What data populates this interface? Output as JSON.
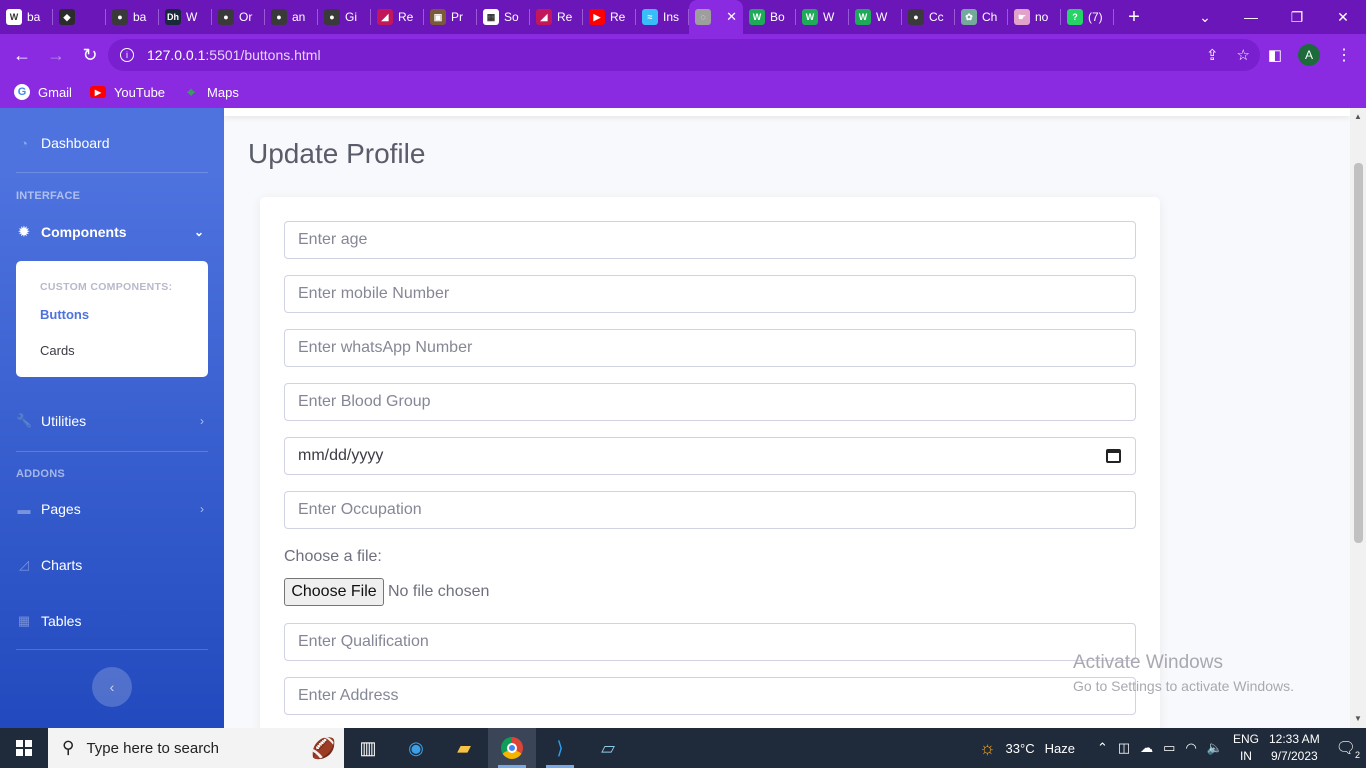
{
  "browser": {
    "tabs": [
      {
        "label": "ba",
        "icon": "w-icon",
        "color": "#ffffff",
        "text": "W"
      },
      {
        "label": "",
        "icon": "diamond-icon",
        "color": "#2c2c2c",
        "text": "◆"
      },
      {
        "label": "ba",
        "icon": "github-icon",
        "color": "#3a3a3a",
        "text": "●"
      },
      {
        "label": "W",
        "icon": "dh-icon",
        "color": "#1b2a3a",
        "text": "Dh"
      },
      {
        "label": "Or",
        "icon": "github-icon",
        "color": "#3a3a3a",
        "text": "●"
      },
      {
        "label": "an",
        "icon": "github-icon",
        "color": "#3a3a3a",
        "text": "●"
      },
      {
        "label": "Gi",
        "icon": "github-icon",
        "color": "#3a3a3a",
        "text": "●"
      },
      {
        "label": "Re",
        "icon": "redux-icon",
        "color": "#c2185b",
        "text": "◢"
      },
      {
        "label": "Pr",
        "icon": "photo-icon",
        "color": "#7a5a3a",
        "text": "▣"
      },
      {
        "label": "So",
        "icon": "square-icon",
        "color": "#ffffff",
        "text": "▦"
      },
      {
        "label": "Re",
        "icon": "redux-icon",
        "color": "#c2185b",
        "text": "◢"
      },
      {
        "label": "Re",
        "icon": "youtube-icon",
        "color": "#ff0000",
        "text": "▶"
      },
      {
        "label": "Ins",
        "icon": "tailwind-icon",
        "color": "#38bdf8",
        "text": "≈"
      },
      {
        "label": "",
        "icon": "globe-icon",
        "color": "#9e9e9e",
        "text": "◌",
        "active": true
      },
      {
        "label": "Bo",
        "icon": "w-green-icon",
        "color": "#1faa59",
        "text": "W"
      },
      {
        "label": "W",
        "icon": "w-green-icon",
        "color": "#1faa59",
        "text": "W"
      },
      {
        "label": "W",
        "icon": "w-green-icon",
        "color": "#1faa59",
        "text": "W"
      },
      {
        "label": "Cc",
        "icon": "github-icon",
        "color": "#3a3a3a",
        "text": "●"
      },
      {
        "label": "Ch",
        "icon": "chatgpt-icon",
        "color": "#74aa9c",
        "text": "✿"
      },
      {
        "label": "no",
        "icon": "hand-icon",
        "color": "#e1a3c9",
        "text": "☛"
      },
      {
        "label": "(7)",
        "icon": "whatsapp-icon",
        "color": "#25d366",
        "text": "?"
      }
    ],
    "address_host": "127.0.0.1",
    "address_path": ":5501/buttons.html",
    "avatar_letter": "A",
    "bookmarks": [
      {
        "label": "Gmail",
        "icon": "google-icon"
      },
      {
        "label": "YouTube",
        "icon": "youtube-icon"
      },
      {
        "label": "Maps",
        "icon": "maps-icon"
      }
    ]
  },
  "sidebar": {
    "dashboard": "Dashboard",
    "heading_interface": "INTERFACE",
    "components": "Components",
    "collapse_header": "CUSTOM COMPONENTS:",
    "collapse_items": [
      "Buttons",
      "Cards"
    ],
    "utilities": "Utilities",
    "heading_addons": "ADDONS",
    "pages": "Pages",
    "charts": "Charts",
    "tables": "Tables"
  },
  "main": {
    "title": "Update Profile",
    "fields": {
      "age": "Enter age",
      "mobile": "Enter mobile Number",
      "whatsapp": "Enter whatsApp Number",
      "blood_group": "Enter Blood Group",
      "date": "mm/dd/yyyy",
      "occupation": "Enter Occupation",
      "qualification": "Enter Qualification",
      "address": "Enter Address"
    },
    "file_label": "Choose a file:",
    "file_button": "Choose File",
    "file_status": "No file chosen"
  },
  "watermark": {
    "line1": "Activate Windows",
    "line2": "Go to Settings to activate Windows."
  },
  "taskbar": {
    "search_placeholder": "Type here to search",
    "weather_temp": "33°C",
    "weather_text": "Haze",
    "lang_top": "ENG",
    "lang_bottom": "IN",
    "time": "12:33 AM",
    "date": "9/7/2023",
    "notification_count": "2"
  },
  "colors": {
    "browser_frame": "#8a2be2",
    "sidebar_top": "#4e73df",
    "sidebar_bottom": "#224abe",
    "active_link": "#4e73df"
  }
}
